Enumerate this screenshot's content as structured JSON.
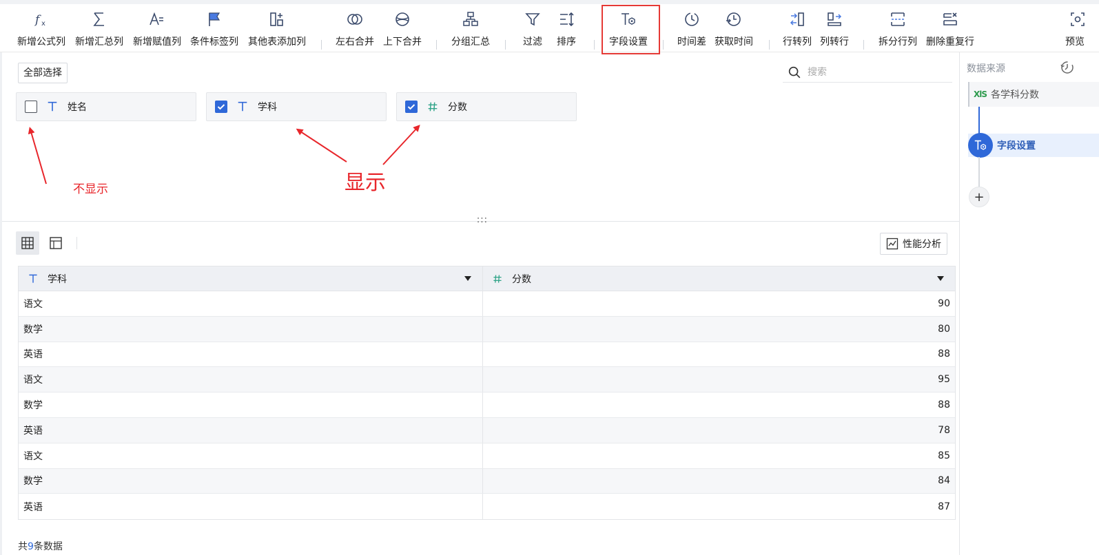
{
  "toolbar": {
    "items": [
      {
        "label": "新增公式列",
        "icon": "formula-icon"
      },
      {
        "label": "新增汇总列",
        "icon": "sigma-icon"
      },
      {
        "label": "新增赋值列",
        "icon": "assign-icon"
      },
      {
        "label": "条件标签列",
        "icon": "flag-icon"
      },
      {
        "label": "其他表添加列",
        "icon": "add-column-icon"
      },
      {
        "label": "左右合并",
        "icon": "merge-horizontal-icon"
      },
      {
        "label": "上下合并",
        "icon": "merge-vertical-icon"
      },
      {
        "label": "分组汇总",
        "icon": "group-icon"
      },
      {
        "label": "过滤",
        "icon": "filter-icon"
      },
      {
        "label": "排序",
        "icon": "sort-icon"
      },
      {
        "label": "字段设置",
        "icon": "field-settings-icon"
      },
      {
        "label": "时间差",
        "icon": "clock-icon"
      },
      {
        "label": "获取时间",
        "icon": "clock-arrow-icon"
      },
      {
        "label": "行转列",
        "icon": "row-to-column-icon"
      },
      {
        "label": "列转行",
        "icon": "column-to-row-icon"
      },
      {
        "label": "拆分行列",
        "icon": "split-icon"
      },
      {
        "label": "删除重复行",
        "icon": "dedupe-icon"
      },
      {
        "label": "预览",
        "icon": "preview-icon"
      }
    ],
    "highlight_color": "#e53935"
  },
  "field_panel": {
    "select_all_label": "全部选择",
    "search_placeholder": "搜索",
    "fields": [
      {
        "name": "姓名",
        "type": "text",
        "checked": false
      },
      {
        "name": "学科",
        "type": "text",
        "checked": true
      },
      {
        "name": "分数",
        "type": "number",
        "checked": true
      }
    ]
  },
  "annotations": {
    "hidden_label": "不显示",
    "shown_label": "显示",
    "color": "#e8262b"
  },
  "preview": {
    "drag_handle": ":::",
    "perf_button_label": "性能分析",
    "columns": [
      {
        "name": "学科",
        "type": "text"
      },
      {
        "name": "分数",
        "type": "number"
      }
    ],
    "rows": [
      [
        "语文",
        "90"
      ],
      [
        "数学",
        "80"
      ],
      [
        "英语",
        "88"
      ],
      [
        "语文",
        "95"
      ],
      [
        "数学",
        "88"
      ],
      [
        "英语",
        "78"
      ],
      [
        "语文",
        "85"
      ],
      [
        "数学",
        "84"
      ],
      [
        "英语",
        "87"
      ]
    ],
    "footer_prefix": "共",
    "footer_count": "9",
    "footer_suffix": "条数据"
  },
  "right_panel": {
    "title": "数据来源",
    "source_badge": "XlS",
    "source_name": "各学科分数",
    "step_label": "字段设置",
    "add_label": "+"
  },
  "colors": {
    "accent": "#2f68d8",
    "text_type_icon": "#2f68d8",
    "number_type_icon": "#2ea387"
  }
}
